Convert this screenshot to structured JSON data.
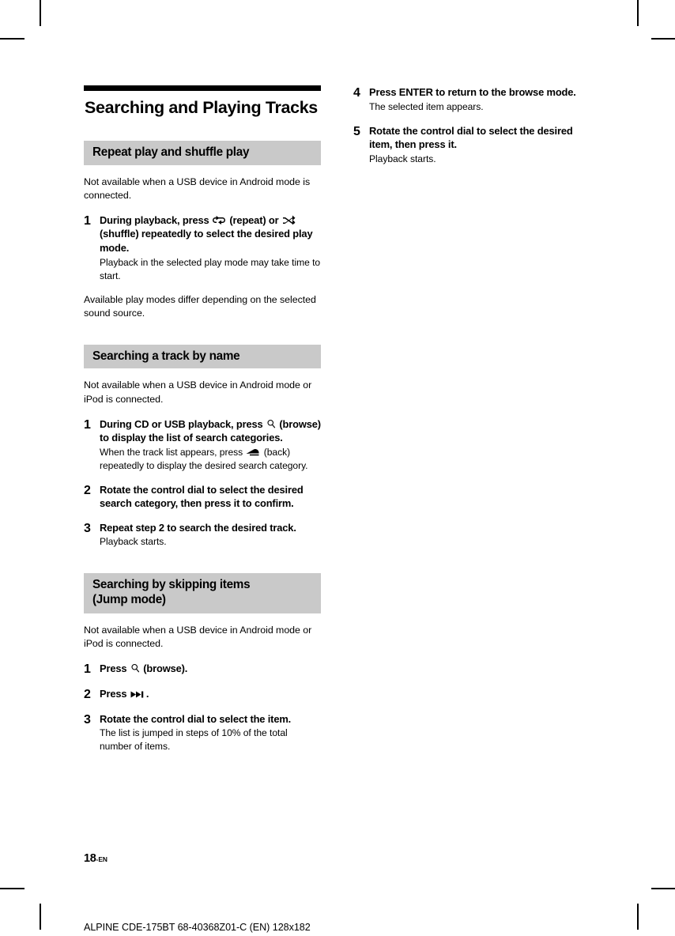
{
  "document": {
    "chapter_title": "Searching and Playing Tracks",
    "page_number": "18",
    "page_number_suffix": "-EN",
    "footer": "ALPINE CDE-175BT 68-40368Z01-C (EN) 128x182",
    "header_bar_color": "#c9c9c9",
    "rule_color": "#000000"
  },
  "sections": [
    {
      "heading_line1": "Repeat play and shuffle play",
      "heading_line2": "",
      "intro": "Not available when a USB device in Android mode is connected.",
      "steps": [
        {
          "number": "1",
          "title_parts": [
            "During playback, press ",
            "repeat-icon",
            " (repeat) or ",
            "shuffle-icon",
            " (shuffle) repeatedly to select the desired play mode."
          ],
          "note": "Playback in the selected play mode may take time to start."
        }
      ],
      "outro": "Available play modes differ depending on the selected sound source."
    },
    {
      "heading_line1": "Searching a track by name",
      "heading_line2": "",
      "intro": "Not available when a USB device in Android mode or iPod is connected.",
      "steps": [
        {
          "number": "1",
          "title_parts": [
            "During CD or USB playback, press ",
            "browse-icon",
            " (browse) to display the list of search categories."
          ],
          "note_parts": [
            "When the track list appears, press ",
            "back-icon",
            " (back) repeatedly to display the desired search category."
          ]
        },
        {
          "number": "2",
          "title": "Rotate the control dial to select the desired search category, then press it to confirm.",
          "note": ""
        },
        {
          "number": "3",
          "title": "Repeat step 2 to search the desired track.",
          "note": "Playback starts."
        }
      ],
      "outro": ""
    },
    {
      "heading_line1": "Searching by skipping items",
      "heading_line2": "(Jump mode)",
      "intro": "Not available when a USB device in Android mode or iPod is connected.",
      "steps": [
        {
          "number": "1",
          "title_parts": [
            "Press ",
            "browse-icon",
            " (browse)."
          ],
          "note": ""
        },
        {
          "number": "2",
          "title_parts": [
            "Press ",
            "skip-forward-icon",
            "."
          ],
          "note": ""
        },
        {
          "number": "3",
          "title": "Rotate the control dial to select the item.",
          "note": "The list is jumped in steps of 10% of the total number of items."
        }
      ],
      "outro": ""
    }
  ],
  "right_column_steps": [
    {
      "number": "4",
      "title": "Press ENTER to return to the browse mode.",
      "note": "The selected item appears."
    },
    {
      "number": "5",
      "title": "Rotate the control dial to select the desired item, then press it.",
      "note": "Playback starts."
    }
  ],
  "text_fragments": {
    "during_playback_a": "During playback, press ",
    "during_playback_b": " (repeat) or ",
    "during_playback_c": " (shuffle) repeatedly to select the desired play mode.",
    "cd_usb_a": "During CD or USB playback, press ",
    "cd_usb_b": " (browse) to display the list of search categories.",
    "track_list_a": "When the track list appears, press ",
    "track_list_b": " (back) repeatedly to display the desired search category.",
    "press_browse_a": "Press ",
    "press_browse_b": " (browse).",
    "press_skip_a": "Press ",
    "press_skip_b": "."
  }
}
